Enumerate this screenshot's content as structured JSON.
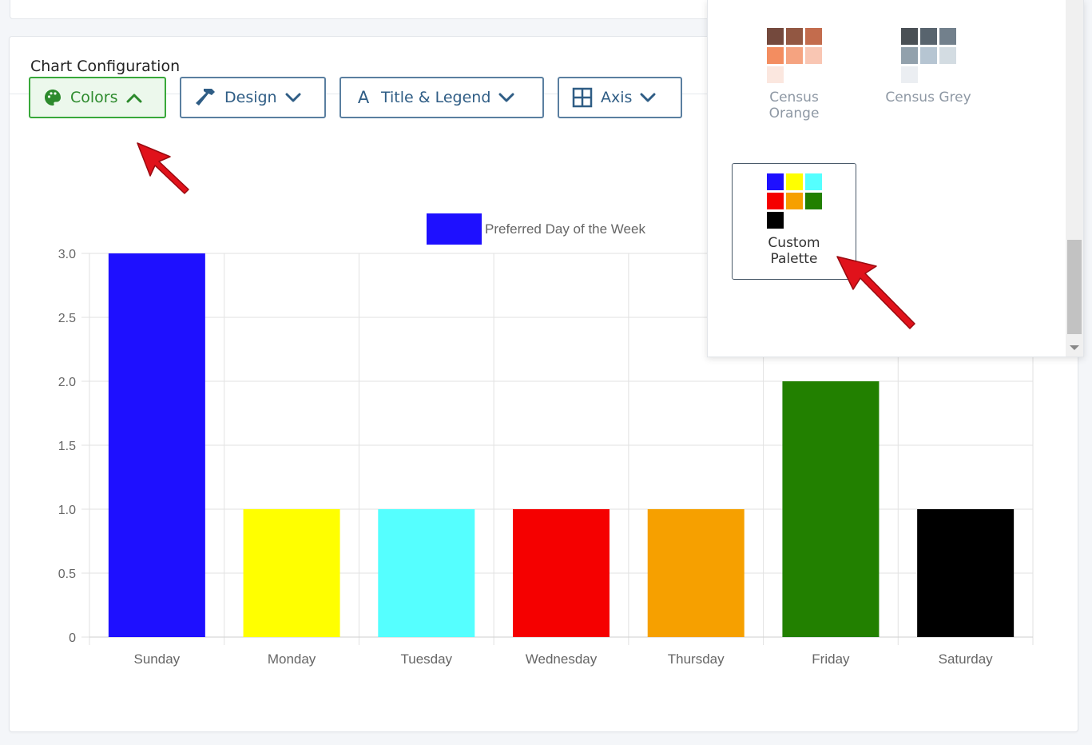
{
  "card": {
    "title": "Chart Configuration"
  },
  "toolbar": {
    "colors_label": "Colors",
    "design_label": "Design",
    "title_legend_label": "Title & Legend",
    "axis_label": "Axis",
    "title_legend_glyph": "A"
  },
  "palette_dropdown": {
    "palettes": [
      {
        "name_line1": "Census",
        "name_line2": "Orange",
        "colors": [
          "#5c2a1c",
          "#803a22",
          "#b9532f",
          "#f27a45",
          "#f4936a",
          "#f8bda6",
          "#fbe3da"
        ]
      },
      {
        "name_line1": "Census Grey",
        "name_line2": "",
        "colors": [
          "#2b3238",
          "#3b4a55",
          "#5a6b78",
          "#7f919e",
          "#aabccb",
          "#ccd6de",
          "#e8ecf0"
        ]
      },
      {
        "name_line1": "Custom",
        "name_line2": "Palette",
        "colors": [
          "#1e10ff",
          "#ffff00",
          "#55ffff",
          "#f50000",
          "#f6a000",
          "#228000",
          "#000000"
        ]
      }
    ]
  },
  "chart_data": {
    "type": "bar",
    "title": "",
    "xlabel": "",
    "ylabel": "",
    "categories": [
      "Sunday",
      "Monday",
      "Tuesday",
      "Wednesday",
      "Thursday",
      "Friday",
      "Saturday"
    ],
    "series": [
      {
        "name": "Preferred Day of the Week",
        "values": [
          3,
          1,
          1,
          1,
          1,
          2,
          1
        ]
      }
    ],
    "bar_colors": [
      "#1e10ff",
      "#ffff00",
      "#55ffff",
      "#f50000",
      "#f6a000",
      "#228000",
      "#000000"
    ],
    "legend_color": "#1e10ff",
    "ylim": [
      0,
      3
    ],
    "yticks": [
      "0",
      "0.5",
      "1.0",
      "1.5",
      "2.0",
      "2.5",
      "3.0"
    ],
    "ytick_values": [
      0,
      0.5,
      1,
      1.5,
      2,
      2.5,
      3
    ],
    "grid": true,
    "legend_position": "top"
  },
  "colors": {
    "active_green": "#38a83a",
    "button_blue": "#2f5d85",
    "annotation_red": "#e0121b"
  }
}
